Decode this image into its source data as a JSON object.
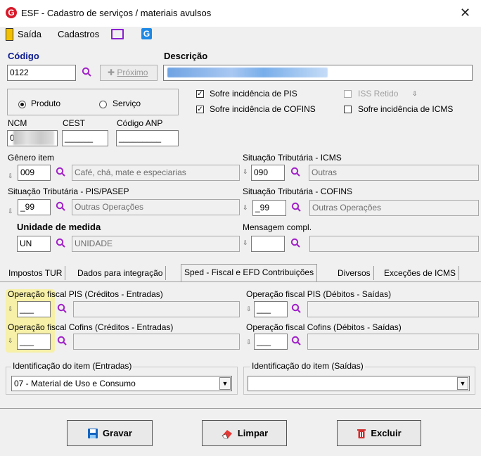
{
  "window": {
    "title": "ESF - Cadastro de serviços / materiais avulsos",
    "close": "✕",
    "logo": "G"
  },
  "menu": {
    "saida": "Saída",
    "cadastros": "Cadastros"
  },
  "codigo": {
    "label": "Código",
    "value": "0122",
    "proximo": "Próximo"
  },
  "descricao": {
    "label": "Descrição"
  },
  "tipo": {
    "produto": "Produto",
    "servico": "Serviço",
    "selected": "Produto"
  },
  "incidencias": {
    "pis": "Sofre incidência de PIS",
    "cofins": "Sofre incidência de COFINS",
    "iss": "ISS Retido",
    "icms": "Sofre incidência de ICMS",
    "pis_checked": true,
    "cofins_checked": true,
    "iss_checked": false,
    "icms_checked": false
  },
  "ncm": {
    "label": "NCM",
    "value": "0"
  },
  "cest": {
    "label": "CEST",
    "value": "______"
  },
  "anp": {
    "label": "Código ANP",
    "value": "_________"
  },
  "genero": {
    "label": "Gênero item",
    "code": "009",
    "desc": "Café, chá, mate e especiarias"
  },
  "sit_icms": {
    "label": "Situação Tributária - ICMS",
    "code": "090",
    "desc": "Outras"
  },
  "sit_pis": {
    "label": "Situação Tributária - PIS/PASEP",
    "code": "_99",
    "desc": "Outras Operações"
  },
  "sit_cofins": {
    "label": "Situação Tributária - COFINS",
    "code": "_99",
    "desc": "Outras Operações"
  },
  "unidade": {
    "label": "Unidade de medida",
    "code": "UN",
    "desc": "UNIDADE"
  },
  "mensagem": {
    "label": "Mensagem compl.",
    "code": "",
    "desc": ""
  },
  "tabs": [
    {
      "label": "Impostos TUR"
    },
    {
      "label": "Dados para integração"
    },
    {
      "label": "Sped - Fiscal e EFD Contribuições"
    },
    {
      "label": "Diversos"
    },
    {
      "label": "Exceções de ICMS"
    }
  ],
  "sped": {
    "pis_entradas": {
      "label": "Operação fiscal PIS (Créditos - Entradas)",
      "code": "___"
    },
    "pis_saidas": {
      "label": "Operação fiscal PIS (Débitos - Saídas)",
      "code": "___"
    },
    "cofins_entradas": {
      "label": "Operação fiscal Cofins (Créditos - Entradas)",
      "code": "___"
    },
    "cofins_saidas": {
      "label": "Operação fiscal Cofins (Débitos - Saídas)",
      "code": "___"
    },
    "ident_entradas": {
      "label": "Identificação do item (Entradas)",
      "value": "07 - Material de Uso e Consumo"
    },
    "ident_saidas": {
      "label": "Identificação do item (Saídas)",
      "value": ""
    }
  },
  "buttons": {
    "gravar": "Gravar",
    "limpar": "Limpar",
    "excluir": "Excluir"
  }
}
